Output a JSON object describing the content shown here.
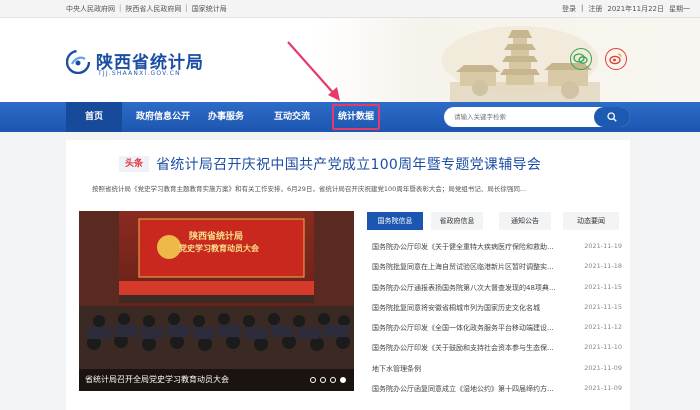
{
  "topbar": {
    "links": [
      "中央人民政府网",
      "陕西省人民政府网",
      "国家统计局"
    ],
    "separator": "|",
    "login": "登录",
    "register": "注册",
    "date": "2021年11月22日",
    "weekday": "星期一"
  },
  "header": {
    "title": "陕西省统计局",
    "domain": "TJJ.SHAANXI.GOV.CN"
  },
  "nav": {
    "items": [
      "首页",
      "政府信息公开",
      "办事服务",
      "互动交流",
      "统计数据"
    ],
    "search_placeholder": "请输入关键字检索"
  },
  "headline": {
    "tag": "头条",
    "title": "省统计局召开庆祝中国共产党成立100周年暨专题党课辅导会",
    "summary": "按照省统计局《党史学习教育主题教育实施方案》和有关工作安排，6月29日，省统计局召开庆祝建党100周年暨表彰大会；局党组书记、局长徐强同..."
  },
  "photo": {
    "banner_line1": "陕西省统计局",
    "banner_line2": "党史学习教育动员大会",
    "caption": "省统计局召开全局党史学习教育动员大会"
  },
  "tabs": [
    "国务院信息",
    "省政府信息",
    "通知公告",
    "动态要闻"
  ],
  "news": [
    {
      "title": "国务院办公厅印发《关于健全重特大疾病医疗保险和救助...",
      "date": "2021-11-19"
    },
    {
      "title": "国务院批复同意在上海自贸试验区临港新片区暂时调整实...",
      "date": "2021-11-18"
    },
    {
      "title": "国务院办公厅通报表扬国务院第八次大督查发现的48项典...",
      "date": "2021-11-15"
    },
    {
      "title": "国务院批复同意将安徽省桐城市列为国家历史文化名城",
      "date": "2021-11-15"
    },
    {
      "title": "国务院办公厅印发《全国一体化政务服务平台移动端建设...",
      "date": "2021-11-12"
    },
    {
      "title": "国务院办公厅印发《关于鼓励和支持社会资本参与生态保...",
      "date": "2021-11-10"
    },
    {
      "title": "地下水管理条例",
      "date": "2021-11-09"
    },
    {
      "title": "国务院办公厅函复同意成立《湿地公约》第十四届缔约方...",
      "date": "2021-11-09"
    }
  ],
  "colors": {
    "brand_blue": "#1d56b0",
    "highlight_box": "#e53a6a",
    "headline_tag_red": "#e0383e"
  }
}
